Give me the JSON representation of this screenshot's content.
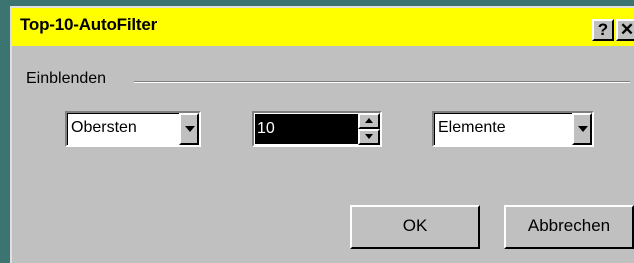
{
  "dialog": {
    "title": "Top-10-AutoFilter",
    "help_label": "?",
    "close_label": "✕"
  },
  "group": {
    "label": "Einblenden"
  },
  "position_select": {
    "value": "Obersten"
  },
  "count_spinner": {
    "value": "10"
  },
  "unit_select": {
    "value": "Elemente"
  },
  "buttons": {
    "ok_label": "OK",
    "cancel_label": "Abbrechen"
  },
  "colors": {
    "desktop": "#3b7470",
    "titlebar": "#ffff00",
    "face": "#c0c0c0",
    "selection": "#000000"
  }
}
